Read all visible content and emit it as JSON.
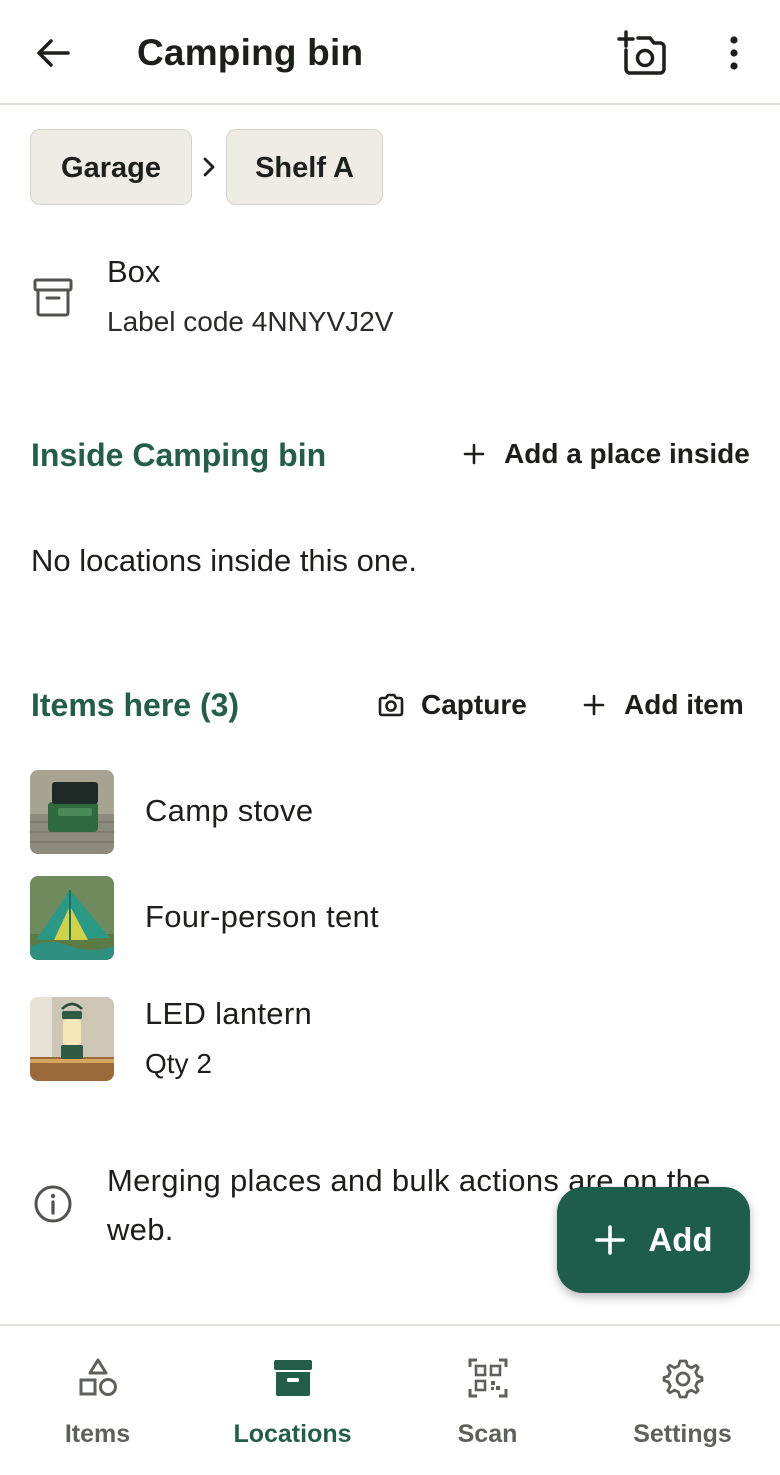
{
  "header": {
    "title": "Camping bin",
    "back_icon": "arrow-left-icon",
    "add_photo_icon": "add-photo-camera-icon",
    "more_icon": "more-vertical-icon"
  },
  "breadcrumb": {
    "items": [
      "Garage",
      "Shelf A"
    ],
    "separator_icon": "chevron-right-icon"
  },
  "location": {
    "kind": "Box",
    "label_code": "Label code 4NNYVJ2V",
    "icon": "archive-box-icon"
  },
  "inside": {
    "title": "Inside Camping bin",
    "add_label": "Add a place inside",
    "empty_text": "No locations inside this one."
  },
  "items_section": {
    "title": "Items here (3)",
    "capture_label": "Capture",
    "add_label": "Add item",
    "items": [
      {
        "name": "Camp stove",
        "qty": ""
      },
      {
        "name": "Four-person tent",
        "qty": ""
      },
      {
        "name": "LED lantern",
        "qty": "Qty 2"
      }
    ]
  },
  "info": {
    "text": "Merging places and bulk actions are on the web.",
    "icon": "info-icon"
  },
  "fab": {
    "label": "Add",
    "icon": "plus-icon"
  },
  "nav": {
    "items": [
      {
        "label": "Items",
        "icon": "shapes-icon",
        "active": false
      },
      {
        "label": "Locations",
        "icon": "archive-box-icon",
        "active": true
      },
      {
        "label": "Scan",
        "icon": "qr-code-icon",
        "active": false
      },
      {
        "label": "Settings",
        "icon": "gear-icon",
        "active": false
      }
    ]
  },
  "colors": {
    "accent": "#235e4b",
    "fab": "#1f5d4b",
    "chip_bg": "#eeece4",
    "divider": "#e2e2dc"
  }
}
